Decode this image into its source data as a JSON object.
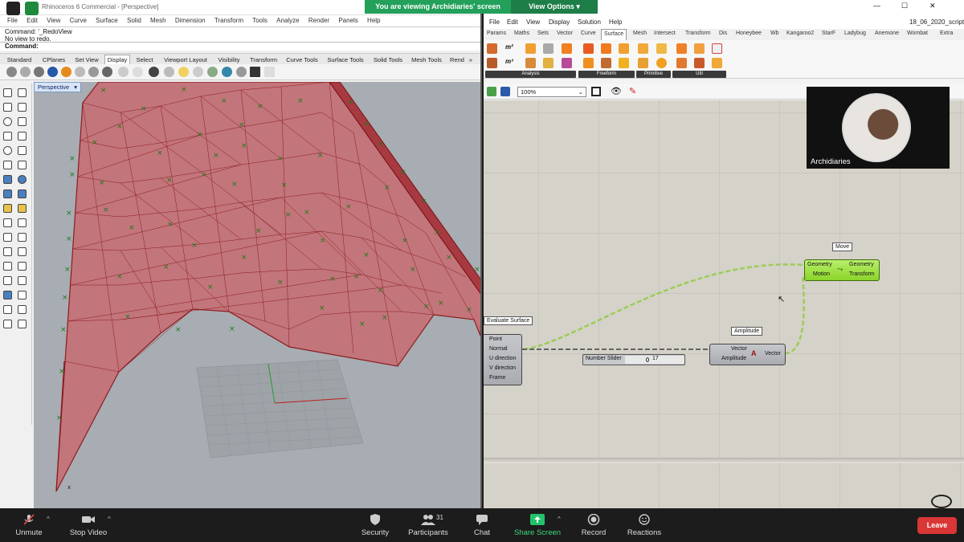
{
  "rhino": {
    "window_title": "Rhinoceros 6 Commercial - [Perspective]",
    "menu": [
      "File",
      "Edit",
      "View",
      "Curve",
      "Surface",
      "Solid",
      "Mesh",
      "Dimension",
      "Transform",
      "Tools",
      "Analyze",
      "Render",
      "Panels",
      "Help"
    ],
    "command_history": [
      "Command: '_RedoView",
      "No view to redo."
    ],
    "command_prompt": "Command:",
    "toolbar_tabs": [
      "Standard",
      "CPlanes",
      "Set View",
      "Display",
      "Select",
      "Viewport Layout",
      "Visibility",
      "Transform",
      "Curve Tools",
      "Surface Tools",
      "Solid Tools",
      "Mesh Tools",
      "Rend"
    ],
    "tabs_overflow": "»",
    "active_tab": "Display",
    "viewport_label": "Perspective",
    "axis_label": "x"
  },
  "gh": {
    "doc_title": "18_06_2020_script3",
    "window_min": "—",
    "window_max": "☐",
    "window_close": "✕",
    "menu": [
      "File",
      "Edit",
      "View",
      "Display",
      "Solution",
      "Help"
    ],
    "tabs": [
      "Params",
      "Maths",
      "Sets",
      "Vector",
      "Curve",
      "Surface",
      "Mesh",
      "Intersect",
      "Transform",
      "Dis",
      "Honeybee",
      "Wb",
      "Kangaroo2",
      "StarF",
      "Ladybug",
      "Anemone",
      "Wombat",
      "Extra"
    ],
    "active_tab": "Surface",
    "ribbon_groups": [
      "Analysis",
      "Freeform",
      "Primitive",
      "Util"
    ],
    "ribbon_glyphs": [
      "m²",
      "m³"
    ],
    "zoom": "100%",
    "components": {
      "evaluate_surface": {
        "title": "Evaluate Surface",
        "outputs": [
          "Point",
          "Normal",
          "U direction",
          "V direction",
          "Frame"
        ]
      },
      "amplitude": {
        "title": "Amplitude",
        "inputs": [
          "Vector",
          "Amplitude"
        ],
        "output": "Vector"
      },
      "move": {
        "title": "Move",
        "inputs": [
          "Geometry",
          "Motion"
        ],
        "outputs": [
          "Geometry",
          "Transform"
        ]
      },
      "slider": {
        "label": "Number Slider",
        "value": "17"
      }
    }
  },
  "zoom": {
    "share_banner": "You are viewing Archidiaries' screen",
    "view_options": "View Options ▾",
    "participant_name": "Archidiaries",
    "participants_count": "31",
    "buttons": {
      "unmute": "Unmute",
      "stop_video": "Stop Video",
      "security": "Security",
      "participants": "Participants",
      "chat": "Chat",
      "share_screen": "Share Screen",
      "record": "Record",
      "reactions": "Reactions",
      "leave": "Leave"
    }
  },
  "colors": {
    "zoom_green": "#23a05a",
    "leave_red": "#d93636",
    "surface_fill": "#c86a6e",
    "surface_edge": "#8c1c22",
    "gh_green": "#8ad42a"
  }
}
